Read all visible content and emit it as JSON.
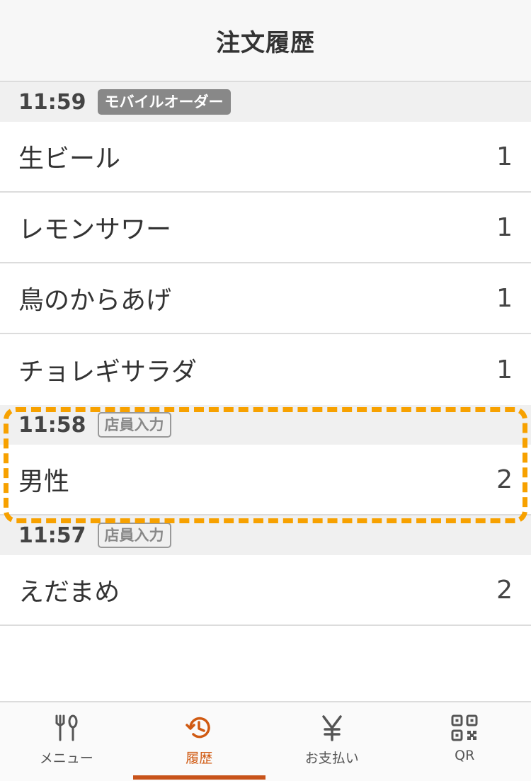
{
  "header": {
    "title": "注文履歴"
  },
  "groups": [
    {
      "time": "11:59",
      "badge": "モバイルオーダー",
      "items": [
        {
          "name": "生ビール",
          "qty": "1"
        },
        {
          "name": "レモンサワー",
          "qty": "1"
        },
        {
          "name": "鳥のからあげ",
          "qty": "1"
        },
        {
          "name": "チョレギサラダ",
          "qty": "1"
        }
      ]
    },
    {
      "time": "11:58",
      "badge": "店員入力",
      "items": [
        {
          "name": "男性",
          "qty": "2"
        }
      ]
    },
    {
      "time": "11:57",
      "badge": "店員入力",
      "items": [
        {
          "name": "えだまめ",
          "qty": "2"
        }
      ]
    }
  ],
  "tabs": [
    {
      "label": "メニュー",
      "icon": "fork-spoon-icon",
      "active": false
    },
    {
      "label": "履歴",
      "icon": "history-icon",
      "active": true
    },
    {
      "label": "お支払い",
      "icon": "yen-icon",
      "active": false
    },
    {
      "label": "QR",
      "icon": "qr-code-icon",
      "active": false
    }
  ],
  "colors": {
    "accent": "#d05a12",
    "highlight": "#f7a100",
    "badge": "#888888"
  }
}
